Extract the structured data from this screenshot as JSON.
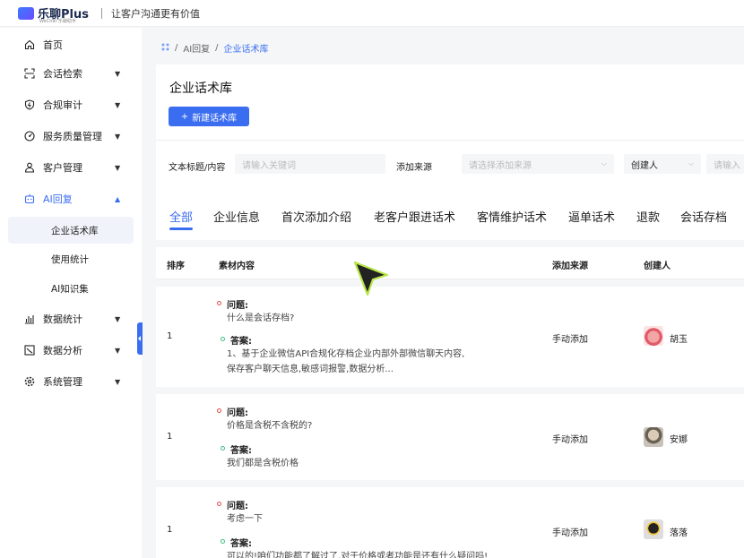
{
  "header": {
    "brand": "乐聊Plus",
    "brand_sub": "WeChat 乐聊助手",
    "slogan": "让客户沟通更有价值"
  },
  "sidebar": {
    "items": [
      {
        "label": "首页",
        "icon": "home-icon"
      },
      {
        "label": "会话检索",
        "icon": "scan-icon"
      },
      {
        "label": "合规审计",
        "icon": "shield-icon"
      },
      {
        "label": "服务质量管理",
        "icon": "gauge-icon"
      },
      {
        "label": "客户管理",
        "icon": "user-icon"
      },
      {
        "label": "AI回复",
        "icon": "robot-icon"
      },
      {
        "label": "数据统计",
        "icon": "bar-chart-icon"
      },
      {
        "label": "数据分析",
        "icon": "trend-icon"
      },
      {
        "label": "系统管理",
        "icon": "gear-icon"
      }
    ],
    "sub_items": [
      "企业话术库",
      "使用统计",
      "AI知识集"
    ]
  },
  "breadcrumb": {
    "parent": "AI回复",
    "current": "企业话术库",
    "sep": "/"
  },
  "page": {
    "title": "企业话术库",
    "new_button": "新建话术库",
    "plus": "+"
  },
  "filters": {
    "title_label": "文本标题/内容",
    "title_placeholder": "请输入关键词",
    "source_label": "添加来源",
    "source_placeholder": "请选择添加来源",
    "creator_value": "创建人",
    "creator_placeholder": "请输入"
  },
  "tabs": [
    "全部",
    "企业信息",
    "首次添加介绍",
    "老客户跟进话术",
    "客情维护话术",
    "逼单话术",
    "退款",
    "会话存档"
  ],
  "table": {
    "headers": [
      "排序",
      "素材内容",
      "添加来源",
      "创建人"
    ],
    "q_label": "问题:",
    "a_label": "答案:",
    "rows": [
      {
        "index": "1",
        "question": "什么是会话存档?",
        "answer_line1": "1、基于企业微信API合规化存档企业内部外部微信聊天内容,",
        "answer_line2": "保存客户聊天信息,敏感词报警,数据分析...",
        "source": "手动添加",
        "creator": "胡玉"
      },
      {
        "index": "1",
        "question": "价格是含税不含税的?",
        "answer_line1": "我们都是含税价格",
        "answer_line2": "",
        "source": "手动添加",
        "creator": "安娜"
      },
      {
        "index": "1",
        "question": "考虑一下",
        "answer_line1": "可以的!咱们功能都了解过了,对于价格或者功能是还有什么疑问吗!",
        "answer_line2": "",
        "source": "手动添加",
        "creator": "落落"
      }
    ]
  },
  "colors": {
    "accent": "#3a6df0",
    "question_dot": "#e04b4b",
    "answer_dot": "#3fbf7f"
  }
}
